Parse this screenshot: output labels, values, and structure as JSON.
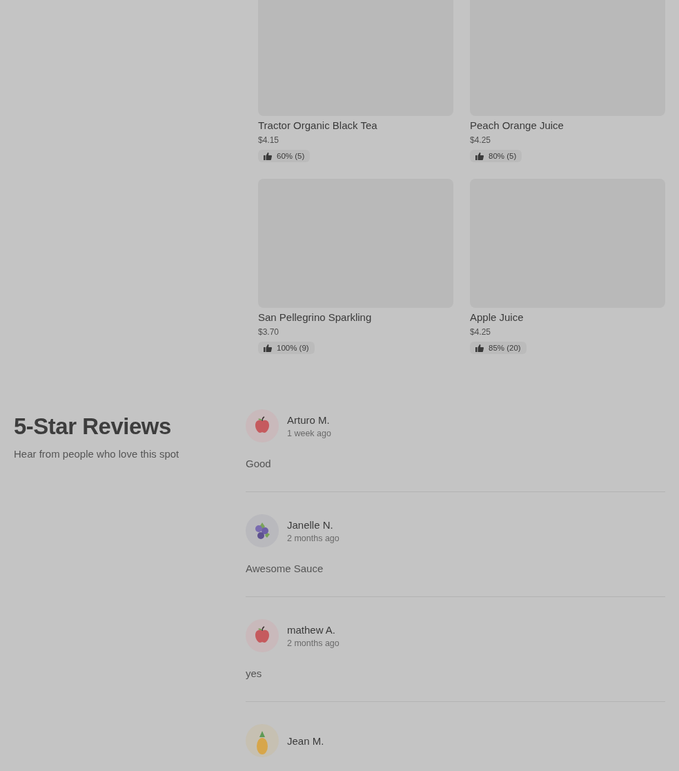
{
  "products": [
    {
      "name": "Tractor Organic Black Tea",
      "price": "$4.15",
      "rating": "60% (5)"
    },
    {
      "name": "Peach Orange Juice",
      "price": "$4.25",
      "rating": "80% (5)"
    },
    {
      "name": "San Pellegrino Sparkling",
      "price": "$3.70",
      "rating": "100% (9)"
    },
    {
      "name": "Apple Juice",
      "price": "$4.25",
      "rating": "85% (20)"
    }
  ],
  "reviews_section": {
    "title": "5-Star Reviews",
    "subtitle": "Hear from people who love this spot"
  },
  "reviews": [
    {
      "name": "Arturo M.",
      "time": "1 week ago",
      "text": "Good",
      "kind": "apple"
    },
    {
      "name": "Janelle N.",
      "time": "2 months ago",
      "text": "Awesome Sauce",
      "kind": "berries"
    },
    {
      "name": "mathew A.",
      "time": "2 months ago",
      "text": "yes",
      "kind": "apple"
    },
    {
      "name": "Jean M.",
      "kind": "pineapple"
    }
  ]
}
